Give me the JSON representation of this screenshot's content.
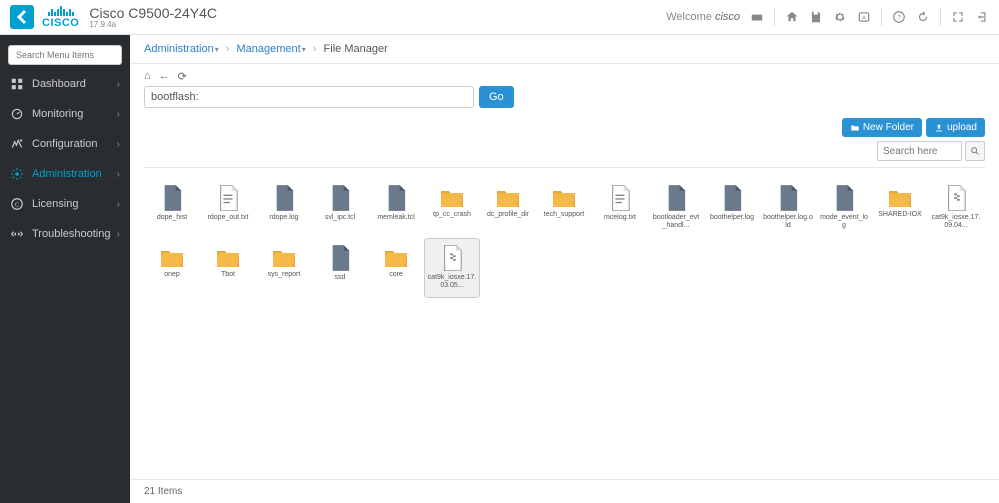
{
  "header": {
    "device_name": "Cisco C9500-24Y4C",
    "version": "17.9.4a",
    "welcome_prefix": "Welcome ",
    "welcome_user": "cisco"
  },
  "sidebar": {
    "search_placeholder": "Search Menu Items",
    "items": [
      {
        "label": "Dashboard",
        "icon": "dashboard"
      },
      {
        "label": "Monitoring",
        "icon": "monitoring"
      },
      {
        "label": "Configuration",
        "icon": "config"
      },
      {
        "label": "Administration",
        "icon": "admin",
        "active": true
      },
      {
        "label": "Licensing",
        "icon": "license"
      },
      {
        "label": "Troubleshooting",
        "icon": "trouble"
      }
    ]
  },
  "breadcrumb": {
    "part1": "Administration",
    "part2": "Management",
    "current": "File Manager"
  },
  "path_input_value": "bootflash:",
  "go_label": "Go",
  "buttons": {
    "new_folder": "New Folder",
    "upload": "upload"
  },
  "search_placeholder": "Search here",
  "files": [
    {
      "name": "dope_hist",
      "type": "file"
    },
    {
      "name": "rdope_out.txt",
      "type": "textfile"
    },
    {
      "name": "rdope.log",
      "type": "file"
    },
    {
      "name": "svl_ipc.tcl",
      "type": "file"
    },
    {
      "name": "memleak.tcl",
      "type": "file"
    },
    {
      "name": "tp_cc_crash",
      "type": "folder"
    },
    {
      "name": "dc_profile_dir",
      "type": "folder"
    },
    {
      "name": "tech_support",
      "type": "folder"
    },
    {
      "name": "mcelog.txt",
      "type": "textfile"
    },
    {
      "name": "bootloader_evt_handl...",
      "type": "file"
    },
    {
      "name": "boothelper.log",
      "type": "file"
    },
    {
      "name": "boothelper.log.old",
      "type": "file"
    },
    {
      "name": "mode_event_log",
      "type": "file"
    },
    {
      "name": "SHARED-IOX",
      "type": "folder"
    },
    {
      "name": "cat9k_iosxe.17.09.04...",
      "type": "archive"
    },
    {
      "name": "onep",
      "type": "folder"
    },
    {
      "name": "Tbot",
      "type": "folder"
    },
    {
      "name": "sys_report",
      "type": "folder"
    },
    {
      "name": "ssd",
      "type": "file"
    },
    {
      "name": "core",
      "type": "folder"
    },
    {
      "name": "cat9k_iosxe.17.03.05...",
      "type": "archive",
      "selected": true
    }
  ],
  "footer": {
    "count_text": "21 Items"
  }
}
